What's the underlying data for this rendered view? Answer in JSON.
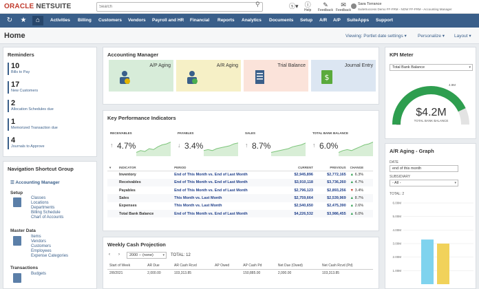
{
  "topbar": {
    "logo_oracle": "ORACLE",
    "logo_netsuite": "NETSUITE",
    "search_placeholder": "Search",
    "help_label": "Help",
    "feedback_label": "Feedback",
    "user_name": "Sara Torrance",
    "user_role": "SuiteSuccess Demo FF-FRM - NOW FF-FRM - Accounting Manager"
  },
  "nav": {
    "items": [
      "Activities",
      "Billing",
      "Customers",
      "Vendors",
      "Payroll and HR",
      "Financial",
      "Reports",
      "Analytics",
      "Documents",
      "Setup",
      "A/R",
      "A/P",
      "SuiteApps",
      "Support"
    ]
  },
  "header": {
    "title": "Home",
    "viewing": "Viewing: Portlet date settings",
    "personalize": "Personalize",
    "layout": "Layout"
  },
  "reminders": {
    "title": "Reminders",
    "items": [
      {
        "count": "10",
        "label": "Bills to Pay"
      },
      {
        "count": "17",
        "label": "New Customers"
      },
      {
        "count": "2",
        "label": "Allocation Schedules due"
      },
      {
        "count": "1",
        "label": "Memorized Transaction due"
      },
      {
        "count": "4",
        "label": "Journals to Approve"
      }
    ]
  },
  "nav_shortcuts": {
    "title": "Navigation Shortcut Group",
    "group": "Accounting Manager",
    "setup_title": "Setup",
    "setup_links": [
      "Classes",
      "Locations",
      "Departments",
      "Billing Schedule",
      "Chart of Accounts"
    ],
    "master_title": "Master Data",
    "master_links": [
      "Items",
      "Vendors",
      "Customers",
      "Employees",
      "Expense Categories"
    ],
    "trans_title": "Transactions",
    "trans_links": [
      "Budgets"
    ]
  },
  "accounting_manager": {
    "title": "Accounting Manager",
    "cards": [
      {
        "label": "A/P Aging",
        "color": "#d7ecd9",
        "icon": "ap-aging-icon"
      },
      {
        "label": "A/R Aging",
        "color": "#f6f0c6",
        "icon": "ar-aging-icon"
      },
      {
        "label": "Trial Balance",
        "color": "#fbe3da",
        "icon": "trial-balance-icon"
      },
      {
        "label": "Journal Entry",
        "color": "#dce6f2",
        "icon": "journal-entry-icon"
      }
    ]
  },
  "kpi": {
    "title": "Key Performance Indicators",
    "boxes": [
      {
        "label": "RECEIVABLES",
        "value": "4.7%",
        "arrow": "↑",
        "trend": [
          2,
          3,
          2.5,
          4,
          3.5,
          5,
          6,
          6.5,
          7.5
        ]
      },
      {
        "label": "PAYABLES",
        "value": "3.4%",
        "arrow": "↓",
        "trend": [
          3,
          3.5,
          3,
          4,
          4.5,
          5,
          5.5,
          6.5,
          7
        ]
      },
      {
        "label": "SALES",
        "value": "8.7%",
        "arrow": "↑",
        "trend": [
          2,
          2.5,
          3,
          3.5,
          4,
          5,
          5.5,
          6,
          7
        ]
      },
      {
        "label": "TOTAL BANK BALANCE",
        "value": "6.0%",
        "arrow": "↑",
        "trend": [
          2,
          3,
          3.5,
          3,
          4,
          5,
          6,
          6.5,
          7.5
        ]
      }
    ],
    "headers": [
      "INDICATOR",
      "PERIOD",
      "CURRENT",
      "PREVIOUS",
      "CHANGE"
    ],
    "rows": [
      {
        "indicator": "Inventory",
        "period": "End of This Month vs. End of Last Month",
        "current": "$2,945,896",
        "previous": "$2,772,165",
        "change": "6.3%",
        "dir": "up"
      },
      {
        "indicator": "Receivables",
        "period": "End of This Month vs. End of Last Month",
        "current": "$3,910,118",
        "previous": "$3,736,260",
        "change": "4.7%",
        "dir": "up"
      },
      {
        "indicator": "Payables",
        "period": "End of This Month vs. End of Last Month",
        "current": "$2,796,123",
        "previous": "$2,893,256",
        "change": "3.4%",
        "dir": "down"
      },
      {
        "indicator": "Sales",
        "period": "This Month vs. Last Month",
        "current": "$2,759,664",
        "previous": "$2,539,969",
        "change": "8.7%",
        "dir": "up"
      },
      {
        "indicator": "Expenses",
        "period": "This Month vs. Last Month",
        "current": "$2,540,650",
        "previous": "$2,475,390",
        "change": "2.6%",
        "dir": "up"
      },
      {
        "indicator": "Total Bank Balance",
        "period": "End of This Month vs. End of Last Month",
        "current": "$4,226,532",
        "previous": "$3,986,455",
        "change": "6.0%",
        "dir": "up"
      }
    ]
  },
  "weekly_cash": {
    "title": "Weekly Cash Projection",
    "range": "2000 -- (none)",
    "total": "TOTAL: 12",
    "headers": [
      "Start of Week",
      "AR Due",
      "AR Cash Rcvd",
      "AP Owed",
      "AP Cash Pd",
      "Net Due (Owed)",
      "Net Cash Rcvd (Pd)"
    ],
    "rows": [
      [
        "2/8/2021",
        "2,000.00",
        "103,313.85",
        "",
        "150,885.00",
        "2,000.00",
        "103,313.85"
      ]
    ]
  },
  "kpi_meter": {
    "title": "KPI Meter",
    "select": "Total Bank Balance",
    "value": "$4.2M",
    "caption": "TOTAL BANK BALANCE",
    "max_label": "4.9M",
    "level": 0.86
  },
  "ar_graph": {
    "title": "A/R Aging - Graph",
    "date_label": "DATE",
    "date_value": "end of this month",
    "subsidiary_label": "SUBSIDIARY",
    "subsidiary_value": "- All -",
    "total": "TOTAL: 2",
    "ytick_labels": [
      "6.00M",
      "5.00M",
      "4.00M",
      "3.00M",
      "2.00M",
      "1.00M"
    ]
  },
  "chart_data": {
    "type": "bar",
    "values": [
      3.3,
      3.0
    ],
    "ylim": [
      0,
      6
    ],
    "colors": [
      "#7fd3ee",
      "#f1d25a"
    ]
  }
}
